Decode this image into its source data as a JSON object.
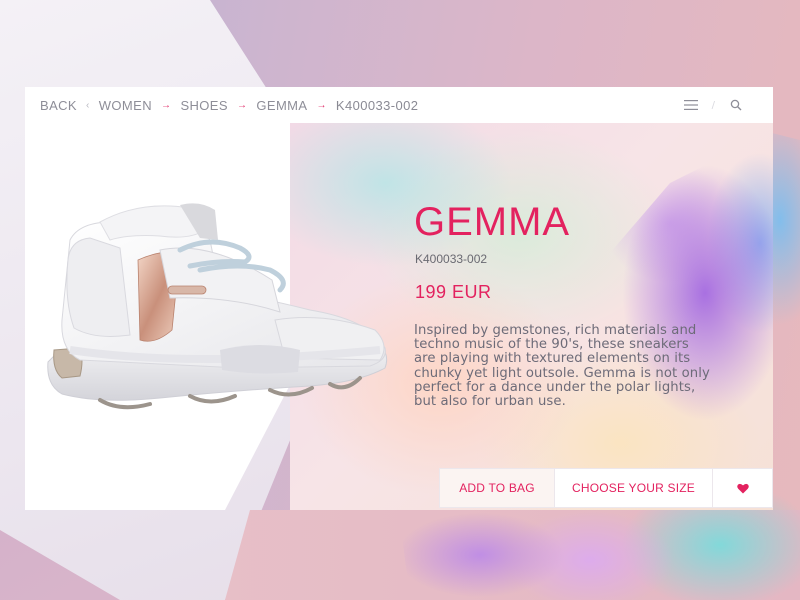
{
  "breadcrumb": {
    "back_label": "BACK",
    "items": [
      "WOMEN",
      "SHOES",
      "GEMMA",
      "K400033-002"
    ]
  },
  "toolbar": {
    "menu_icon": "hamburger-icon",
    "search_icon": "search-icon"
  },
  "product": {
    "name": "GEMMA",
    "sku": "K400033-002",
    "price": "199 EUR",
    "description": "Inspired by gemstones, rich materials and techno music of the 90's, these sneakers are playing with textured elements on its chunky yet light outsole. Gemma is not only perfect for a dance under the polar lights, but also for urban use.",
    "image_icon": "sneaker-image"
  },
  "actions": {
    "add_to_bag": "ADD TO BAG",
    "choose_size": "CHOOSE YOUR SIZE",
    "favorite_icon": "heart-icon"
  },
  "colors": {
    "accent": "#e3225f",
    "text_grey": "#8e8e98"
  }
}
